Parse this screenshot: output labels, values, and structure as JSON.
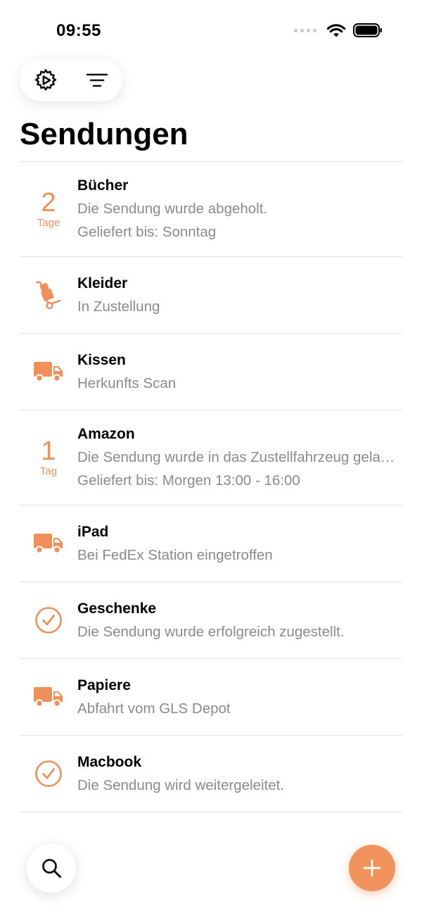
{
  "status_bar": {
    "time": "09:55"
  },
  "header": {
    "title": "Sendungen"
  },
  "colors": {
    "accent": "#ef8f5a",
    "secondary_text": "#8a8a8e",
    "divider": "#e2e2e2"
  },
  "shipments": [
    {
      "name": "Bücher",
      "icon": "days-counter",
      "days": "2",
      "days_unit": "Tage",
      "status": "Die Sendung wurde abgeholt.",
      "eta": "Geliefert bis: Sonntag"
    },
    {
      "name": "Kleider",
      "icon": "hand-truck-icon",
      "status": "In Zustellung"
    },
    {
      "name": "Kissen",
      "icon": "truck-icon",
      "status": "Herkunfts Scan"
    },
    {
      "name": "Amazon",
      "icon": "days-counter",
      "days": "1",
      "days_unit": "Tag",
      "status": "Die Sendung wurde in das Zustellfahrzeug geladen.",
      "eta": "Geliefert bis: Morgen 13:00 - 16:00"
    },
    {
      "name": "iPad",
      "icon": "truck-icon",
      "status": "Bei FedEx Station eingetroffen"
    },
    {
      "name": "Geschenke",
      "icon": "checkmark-circle-icon",
      "status": "Die Sendung wurde erfolgreich zugestellt."
    },
    {
      "name": "Papiere",
      "icon": "truck-icon",
      "status": "Abfahrt vom GLS Depot"
    },
    {
      "name": "Macbook",
      "icon": "checkmark-circle-icon",
      "status": "Die Sendung wird weitergeleitet."
    }
  ]
}
